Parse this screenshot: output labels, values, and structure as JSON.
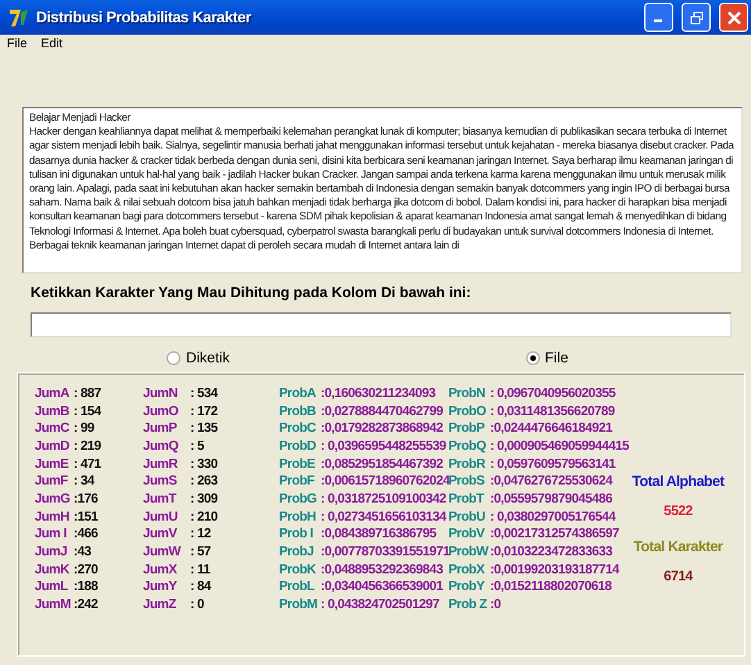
{
  "window": {
    "title": "Distribusi Probabilitas Karakter"
  },
  "menu": [
    "File",
    "Edit"
  ],
  "document": {
    "title": "Belajar Menjadi Hacker",
    "text": "Hacker dengan keahliannya dapat melihat & memperbaiki kelemahan perangkat lunak di komputer; biasanya kemudian di publikasikan secara terbuka di Internet agar sistem menjadi lebih baik. Sialnya, segelintir manusia berhati jahat menggunakan informasi tersebut untuk kejahatan - mereka biasanya disebut cracker. Pada dasarnya dunia hacker & cracker tidak berbeda dengan dunia seni, disini kita berbicara seni keamanan jaringan Internet. Saya berharap ilmu keamanan jaringan di tulisan ini digunakan untuk hal-hal yang baik - jadilah Hacker bukan Cracker. Jangan sampai anda terkena karma karena menggunakan ilmu untuk merusak milik orang lain. Apalagi, pada saat ini kebutuhan akan hacker semakin bertambah di Indonesia dengan semakin banyak dotcommers yang ingin IPO di berbagai bursa saham. Nama baik & nilai sebuah dotcom bisa jatuh bahkan menjadi tidak berharga jika dotcom di bobol. Dalam kondisi ini, para hacker di harapkan bisa menjadi konsultan keamanan bagi para dotcommers tersebut - karena SDM pihak kepolisian & aparat keamanan Indonesia amat sangat lemah & menyedihkan di bidang Teknologi Informasi & Internet. Apa boleh buat cybersquad, cyberpatrol swasta barangkali perlu di budayakan untuk survival dotcommers Indonesia di Internet. Berbagai teknik keamanan jaringan Internet dapat di peroleh secara mudah di Internet antara lain di"
  },
  "prompt": "Ketikkan Karakter Yang Mau Dihitung pada Kolom Di bawah ini:",
  "modes": [
    {
      "label": "Diketik",
      "selected": false
    },
    {
      "label": "File",
      "selected": true
    }
  ],
  "counts": [
    {
      "label": "JumA",
      "value": ": 887"
    },
    {
      "label": "JumB",
      "value": ": 154"
    },
    {
      "label": "JumC",
      "value": ": 99"
    },
    {
      "label": "JumD",
      "value": ": 219"
    },
    {
      "label": "JumE",
      "value": ": 471"
    },
    {
      "label": "JumF",
      "value": ": 34"
    },
    {
      "label": "JumG",
      "value": ":176"
    },
    {
      "label": "JumH",
      "value": ":151"
    },
    {
      "label": "Jum I",
      "value": ":466"
    },
    {
      "label": "JumJ",
      "value": ":43"
    },
    {
      "label": "JumK",
      "value": ":270"
    },
    {
      "label": "JumL",
      "value": ":188"
    },
    {
      "label": "JumM",
      "value": ":242"
    },
    {
      "label": "JumN",
      "value": ": 534"
    },
    {
      "label": "JumO",
      "value": ": 172"
    },
    {
      "label": "JumP",
      "value": ": 135"
    },
    {
      "label": "JumQ",
      "value": ": 5"
    },
    {
      "label": "JumR",
      "value": ": 330"
    },
    {
      "label": "JumS",
      "value": ": 263"
    },
    {
      "label": "JumT",
      "value": ": 309"
    },
    {
      "label": "JumU",
      "value": ": 210"
    },
    {
      "label": "JumV",
      "value": ": 12"
    },
    {
      "label": "JumW",
      "value": ": 57"
    },
    {
      "label": "JumX",
      "value": ": 11"
    },
    {
      "label": "JumY",
      "value": ": 84"
    },
    {
      "label": "JumZ",
      "value": ": 0"
    }
  ],
  "probabilities": [
    {
      "label": "ProbA",
      "value": ":0,160630211234093"
    },
    {
      "label": "ProbB",
      "value": ":0,0278884470462799"
    },
    {
      "label": "ProbC",
      "value": ":0,0179282873868942"
    },
    {
      "label": "ProbD",
      "value": ": 0,0396595448255539"
    },
    {
      "label": "ProbE",
      "value": ":0,0852951854467392"
    },
    {
      "label": "ProbF",
      "value": ":0,00615718960762024"
    },
    {
      "label": "ProbG",
      "value": ": 0,0318725109100342"
    },
    {
      "label": "ProbH",
      "value": ": 0,0273451656103134"
    },
    {
      "label": "Prob I",
      "value": ":0,084389716386795"
    },
    {
      "label": "ProbJ",
      "value": ":0,00778703391551971"
    },
    {
      "label": "ProbK",
      "value": ":0,0488953292369843"
    },
    {
      "label": "ProbL",
      "value": ":0,0340456366539001"
    },
    {
      "label": "ProbM",
      "value": ": 0,043824702501297"
    },
    {
      "label": "ProbN",
      "value": ": 0,0967040956020355"
    },
    {
      "label": "ProbO",
      "value": ": 0,0311481356620789"
    },
    {
      "label": "ProbP",
      "value": ":0,0244476646184921"
    },
    {
      "label": "ProbQ",
      "value": ": 0,000905469059944415"
    },
    {
      "label": "ProbR",
      "value": ": 0,0597609579563141"
    },
    {
      "label": "ProbS",
      "value": ":0,0476276725530624"
    },
    {
      "label": "ProbT",
      "value": ":0,0559579879045486"
    },
    {
      "label": "ProbU",
      "value": ": 0,0380297005176544"
    },
    {
      "label": "ProbV",
      "value": ":0,00217312574386597"
    },
    {
      "label": "ProbW",
      "value": ":0,0103223472833633"
    },
    {
      "label": "ProbX",
      "value": ":0,00199203193187714"
    },
    {
      "label": "ProbY",
      "value": ":0,0152118802070618"
    },
    {
      "label": "Prob Z",
      "value": ":0"
    }
  ],
  "totals": [
    {
      "kind": "alphabet",
      "label": "Total Alphabet",
      "value": "5522"
    },
    {
      "kind": "karakter",
      "label": "Total Karakter",
      "value": "6714"
    }
  ]
}
